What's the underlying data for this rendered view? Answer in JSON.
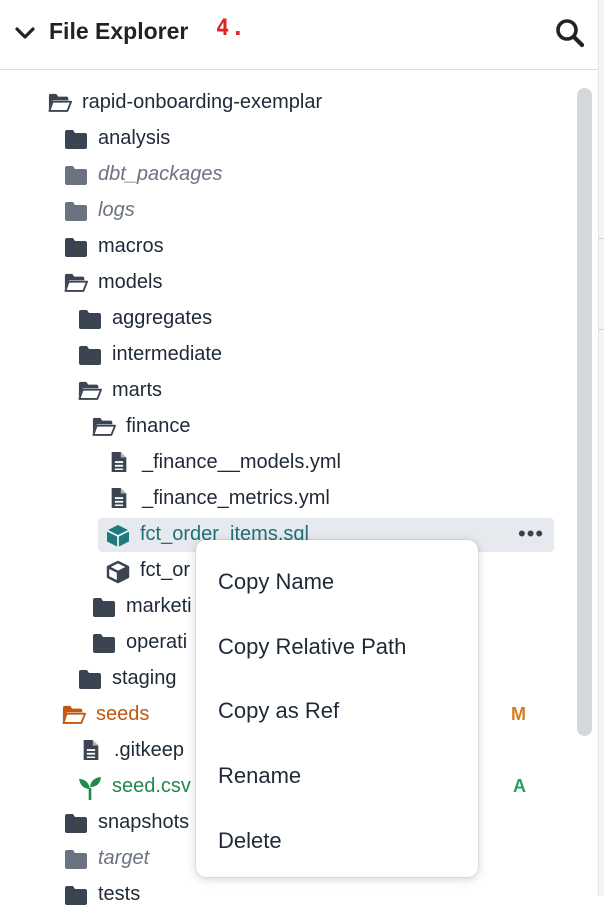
{
  "header": {
    "title": "File Explorer",
    "step_marker": "4."
  },
  "tree": [
    {
      "label": "rapid-onboarding-exemplar",
      "kind": "folder-open",
      "style": ""
    },
    {
      "label": "analysis",
      "kind": "folder",
      "style": ""
    },
    {
      "label": "dbt_packages",
      "kind": "folder",
      "style": "muted"
    },
    {
      "label": "logs",
      "kind": "folder",
      "style": "muted"
    },
    {
      "label": "macros",
      "kind": "folder",
      "style": ""
    },
    {
      "label": "models",
      "kind": "folder-open",
      "style": ""
    },
    {
      "label": "aggregates",
      "kind": "folder",
      "style": ""
    },
    {
      "label": "intermediate",
      "kind": "folder",
      "style": ""
    },
    {
      "label": "marts",
      "kind": "folder-open",
      "style": ""
    },
    {
      "label": "finance",
      "kind": "folder-open",
      "style": ""
    },
    {
      "label": "_finance__models.yml",
      "kind": "file",
      "style": ""
    },
    {
      "label": "_finance_metrics.yml",
      "kind": "file",
      "style": ""
    },
    {
      "label": "fct_order_items.sql",
      "kind": "model",
      "style": "teal",
      "selected": true
    },
    {
      "label": "fct_or",
      "kind": "model-outline",
      "style": ""
    },
    {
      "label": "marketi",
      "kind": "folder",
      "style": ""
    },
    {
      "label": "operati",
      "kind": "folder",
      "style": ""
    },
    {
      "label": "staging",
      "kind": "folder",
      "style": ""
    },
    {
      "label": "seeds",
      "kind": "folder-open",
      "style": "orange",
      "badge": "M"
    },
    {
      "label": ".gitkeep",
      "kind": "file",
      "style": ""
    },
    {
      "label": "seed.csv",
      "kind": "seed",
      "style": "green",
      "badge": "A"
    },
    {
      "label": "snapshots",
      "kind": "folder",
      "style": ""
    },
    {
      "label": "target",
      "kind": "folder",
      "style": "muted"
    },
    {
      "label": "tests",
      "kind": "folder",
      "style": ""
    }
  ],
  "context_menu": {
    "items": [
      "Copy Name",
      "Copy Relative Path",
      "Copy as Ref",
      "Rename",
      "Delete"
    ]
  },
  "more_label": "•••",
  "colors": {
    "folder": "#3b4552",
    "folder_muted": "#6b7280",
    "seeds_orange": "#c2570f",
    "badge_modified": "#d97a1f",
    "badge_added": "#22a05a",
    "model_teal": "#1f7a80",
    "step_red": "#e02424"
  }
}
